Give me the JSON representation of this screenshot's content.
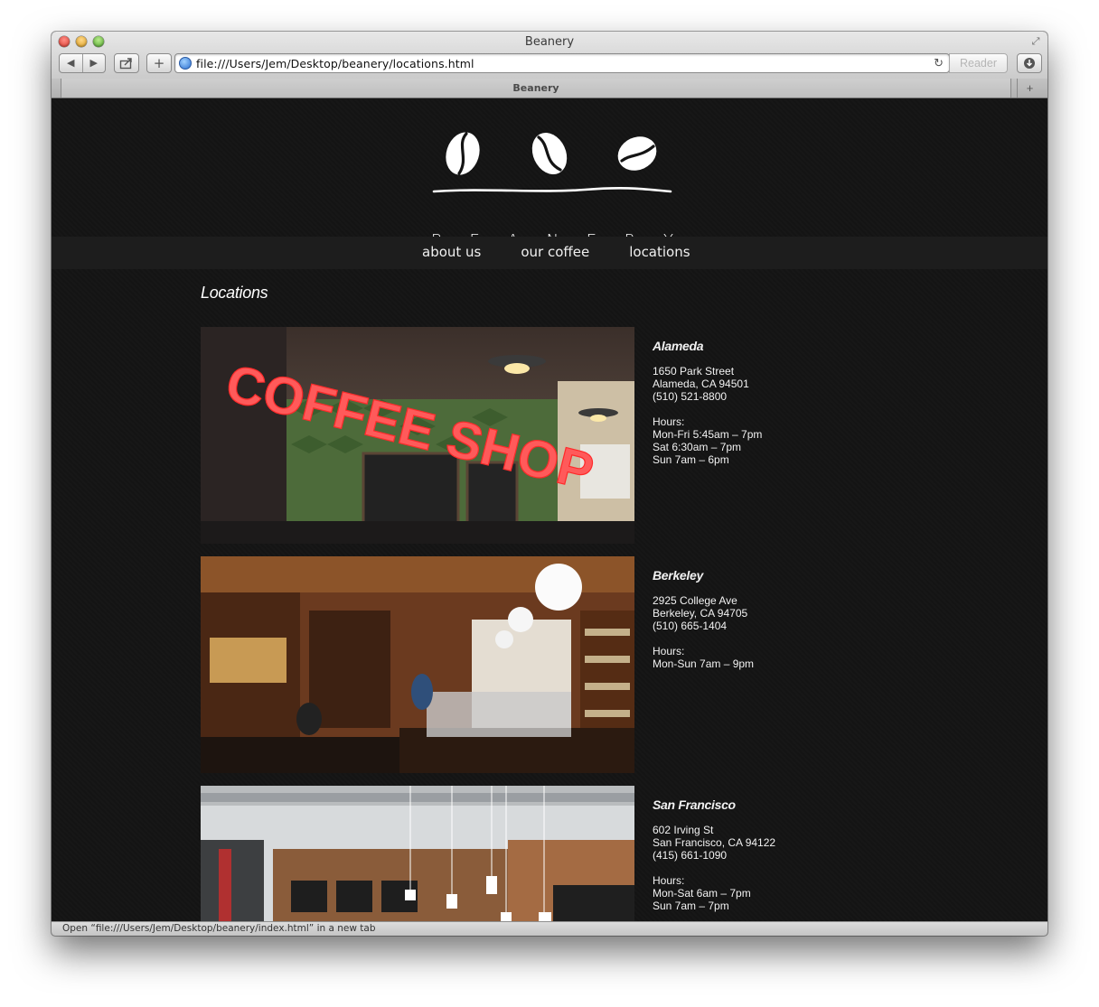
{
  "window": {
    "title": "Beanery",
    "tab_title": "Beanery"
  },
  "toolbar": {
    "back_icon": "back-arrow-icon",
    "forward_icon": "forward-arrow-icon",
    "share_icon": "share-icon",
    "new_tab_symbol": "+",
    "url": "file:///Users/Jem/Desktop/beanery/locations.html",
    "reader_label": "Reader",
    "download_icon": "download-icon"
  },
  "site": {
    "logo_text": [
      "B",
      "E",
      "A",
      "N",
      "E",
      "R",
      "Y"
    ],
    "nav": [
      {
        "label": "about us"
      },
      {
        "label": "our coffee"
      },
      {
        "label": "locations"
      }
    ],
    "page_heading": "Locations"
  },
  "locations": [
    {
      "name": "Alameda",
      "street": "1650 Park Street",
      "city": "Alameda, CA 94501",
      "phone": "(510) 521-8800",
      "hours_label": "Hours:",
      "hours": [
        "Mon-Fri 5:45am – 7pm",
        "Sat 6:30am – 7pm",
        "Sun 7am – 6pm"
      ],
      "photo_sign_text": "COFFEE SHOP"
    },
    {
      "name": "Berkeley",
      "street": "2925 College Ave",
      "city": "Berkeley, CA 94705",
      "phone": "(510) 665-1404",
      "hours_label": "Hours:",
      "hours": [
        "Mon-Sun 7am – 9pm"
      ]
    },
    {
      "name": "San Francisco",
      "street": "602 Irving St",
      "city": "San Francisco, CA 94122",
      "phone": "(415) 661-1090",
      "hours_label": "Hours:",
      "hours": [
        "Mon-Sat 6am – 7pm",
        "Sun 7am – 7pm"
      ]
    }
  ],
  "status_bar": "Open “file:///Users/Jem/Desktop/beanery/index.html” in a new tab",
  "colors": {
    "page_bg": "#141414",
    "nav_bg": "#1d1d1d",
    "text": "#ffffff"
  }
}
